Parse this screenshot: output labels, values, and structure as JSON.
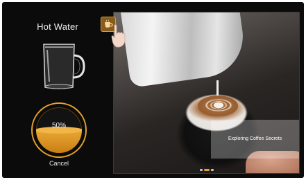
{
  "screen": {
    "title": "Hot Water",
    "progress": {
      "value_label": "50%",
      "fraction": 0.5
    },
    "cancel_label": "Cancel",
    "slideshow": {
      "caption": "Exploring Coffee Secrets",
      "slide_count": 3,
      "active_index": 1
    },
    "icons": {
      "top_button": "coffee-cup-icon",
      "cursor": "pointing-hand-icon"
    },
    "colors": {
      "accent": "#e6a12a",
      "background": "#0b0b0b"
    }
  }
}
